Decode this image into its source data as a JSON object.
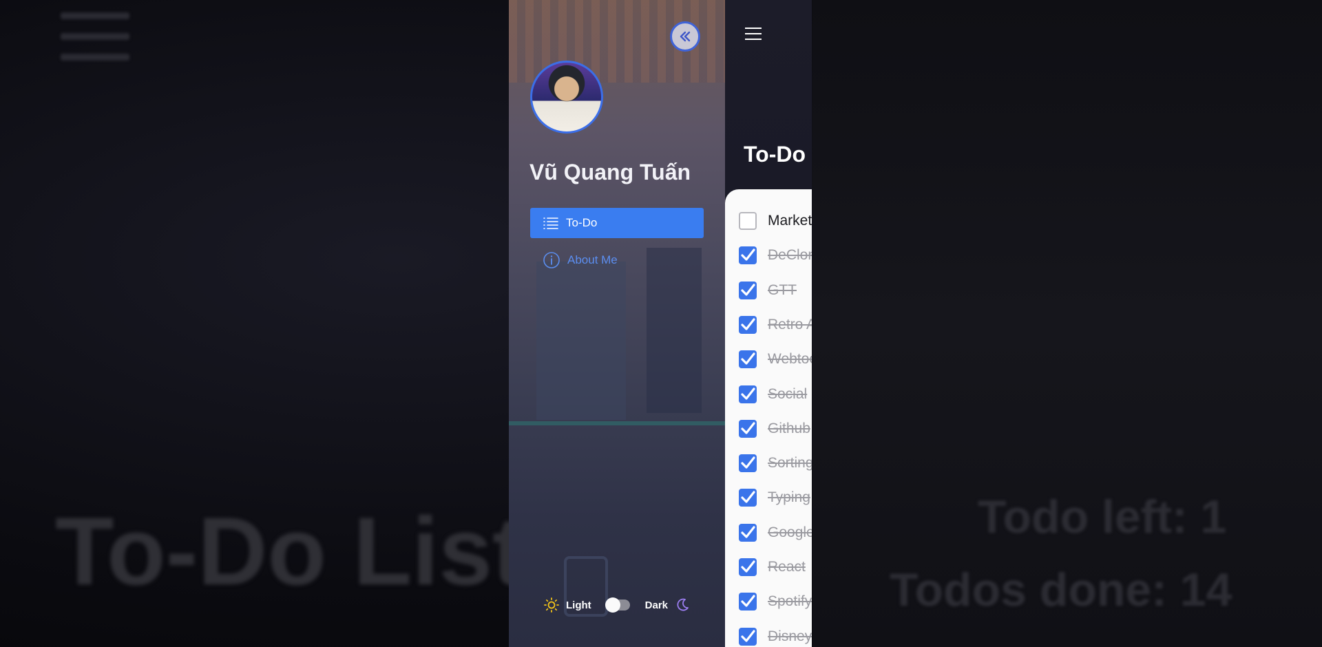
{
  "backdrop": {
    "title_text": "To-Do List",
    "todo_left": "Todo left: 1",
    "todos_done": "Todos done: 14"
  },
  "sidebar": {
    "user_name": "Vũ Quang Tuấn",
    "nav": [
      {
        "label": "To-Do",
        "icon": "list-icon",
        "active": true
      },
      {
        "label": "About Me",
        "icon": "info-icon",
        "active": false
      }
    ],
    "theme": {
      "light_label": "Light",
      "dark_label": "Dark",
      "mode": "light"
    }
  },
  "main": {
    "title": "To-Do",
    "todos": [
      {
        "text": "Market",
        "done": false
      },
      {
        "text": "DeClon",
        "done": true
      },
      {
        "text": "GTT",
        "done": true
      },
      {
        "text": "Retro A",
        "done": true
      },
      {
        "text": "Webtoo",
        "done": true
      },
      {
        "text": "Social",
        "done": true
      },
      {
        "text": "Github",
        "done": true
      },
      {
        "text": "Sorting",
        "done": true
      },
      {
        "text": "Typing",
        "done": true
      },
      {
        "text": "Google",
        "done": true
      },
      {
        "text": "React",
        "done": true
      },
      {
        "text": "Spotify",
        "done": true
      },
      {
        "text": "Disney",
        "done": true
      }
    ]
  },
  "colors": {
    "accent": "#3a7df0",
    "checkbox": "#3a74ea"
  }
}
